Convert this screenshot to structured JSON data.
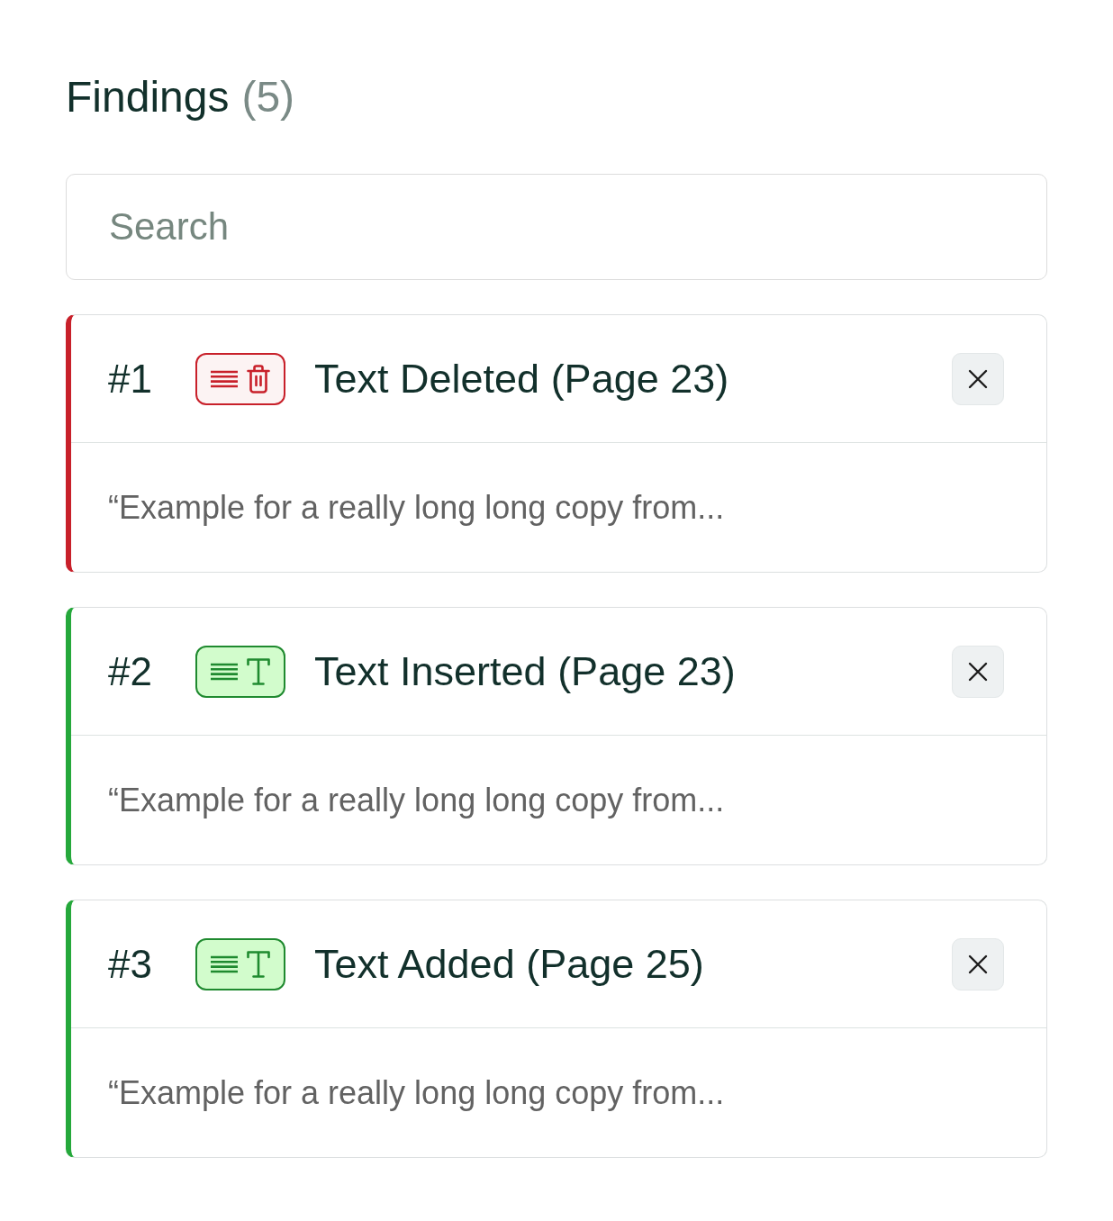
{
  "heading": {
    "title": "Findings",
    "count": "(5)"
  },
  "search": {
    "placeholder": "Search"
  },
  "findings": [
    {
      "number": "#1",
      "kind": "deleted",
      "title": "Text Deleted (Page 23)",
      "excerpt": "“Example for a really long long copy from..."
    },
    {
      "number": "#2",
      "kind": "added",
      "title": "Text Inserted (Page 23)",
      "excerpt": "“Example for a really long long copy from..."
    },
    {
      "number": "#3",
      "kind": "added",
      "title": "Text Added (Page 25)",
      "excerpt": "“Example for a really long long copy from..."
    }
  ]
}
